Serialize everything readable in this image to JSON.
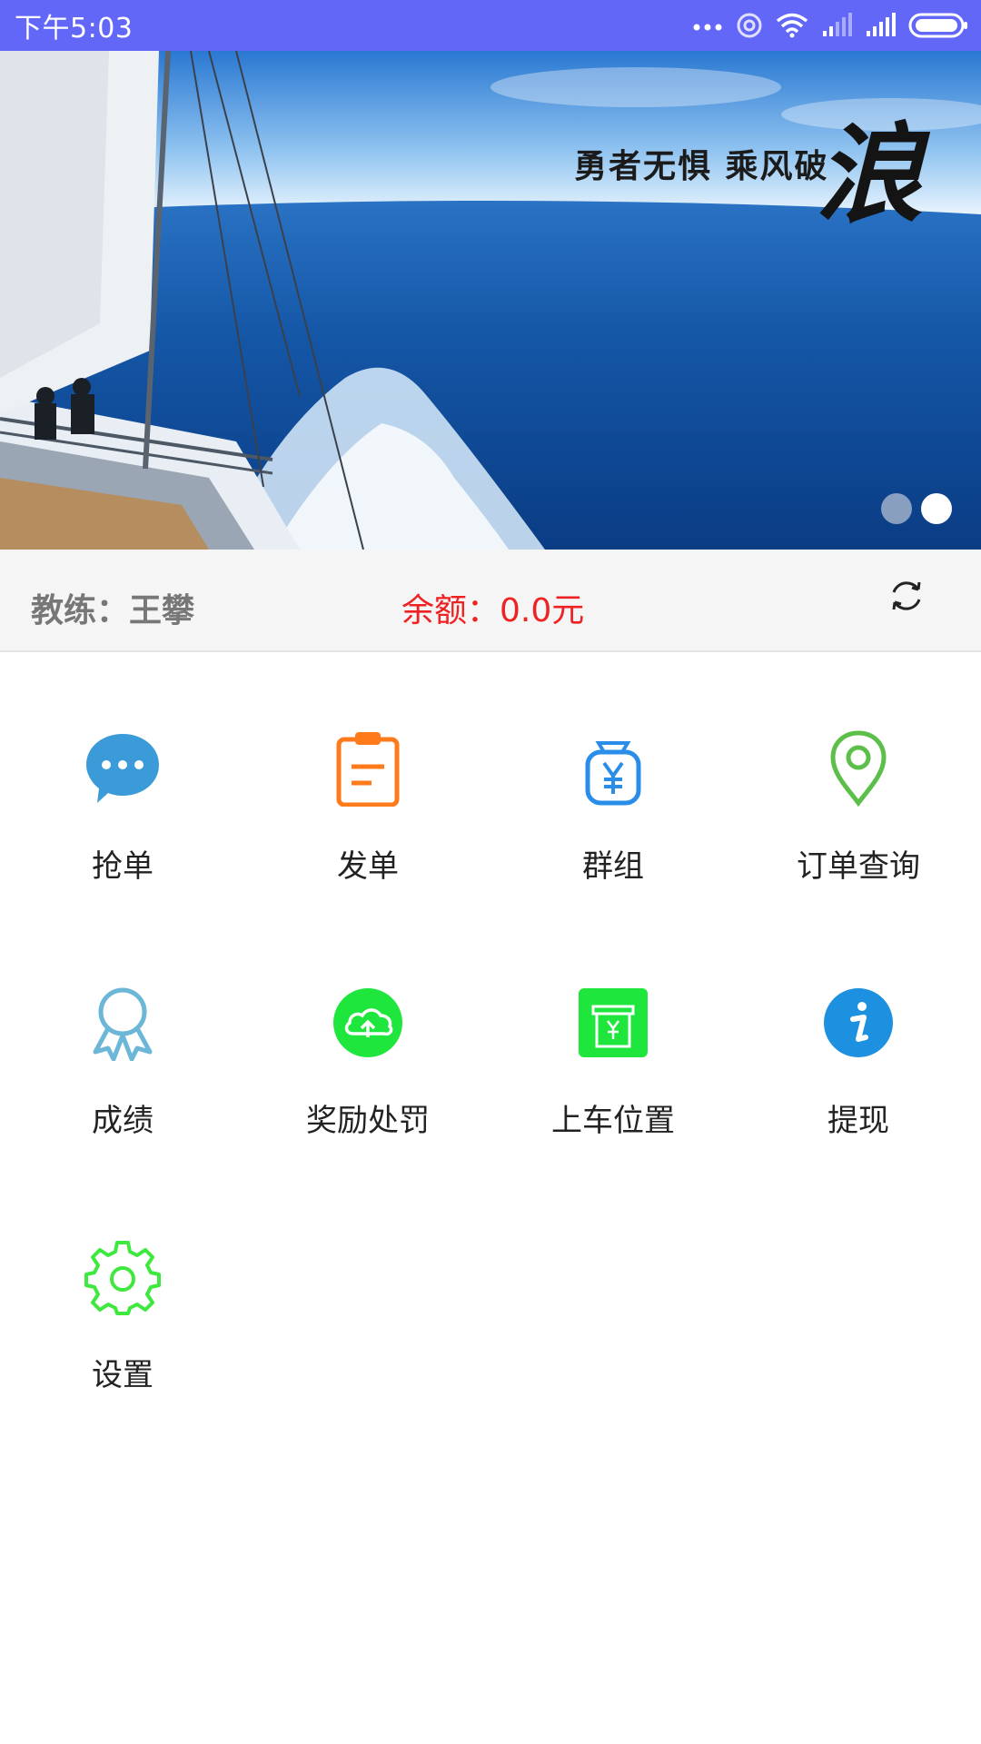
{
  "status_bar": {
    "time": "下午5:03",
    "icons": [
      "more-dots-icon",
      "hotspot-icon",
      "wifi-icon",
      "signal-weak-icon",
      "signal-full-icon",
      "battery-icon"
    ]
  },
  "banner": {
    "slogan": "勇者无惧 乘风破",
    "big_char": "浪",
    "slide_count": 2,
    "active_slide": 2
  },
  "info": {
    "coach": "教练：王攀",
    "balance": "余额：0.0元"
  },
  "menu": {
    "items": [
      {
        "label": "抢单",
        "icon": "chat-bubble-icon",
        "color": "#3a9bd8"
      },
      {
        "label": "发单",
        "icon": "clipboard-icon",
        "color": "#ff7a1a"
      },
      {
        "label": "群组",
        "icon": "money-bag-icon",
        "color": "#2a8de8"
      },
      {
        "label": "订单查询",
        "icon": "location-pin-icon",
        "color": "#5cbf4a"
      },
      {
        "label": "成绩",
        "icon": "award-ribbon-icon",
        "color": "#6cb7d8"
      },
      {
        "label": "奖励处罚",
        "icon": "cloud-upload-icon",
        "color": "#1ee63c"
      },
      {
        "label": "上车位置",
        "icon": "receipt-icon",
        "color": "#1ee63c"
      },
      {
        "label": "提现",
        "icon": "info-icon",
        "color": "#1e90e0"
      },
      {
        "label": "设置",
        "icon": "gear-icon",
        "color": "#3ee83e"
      }
    ]
  }
}
